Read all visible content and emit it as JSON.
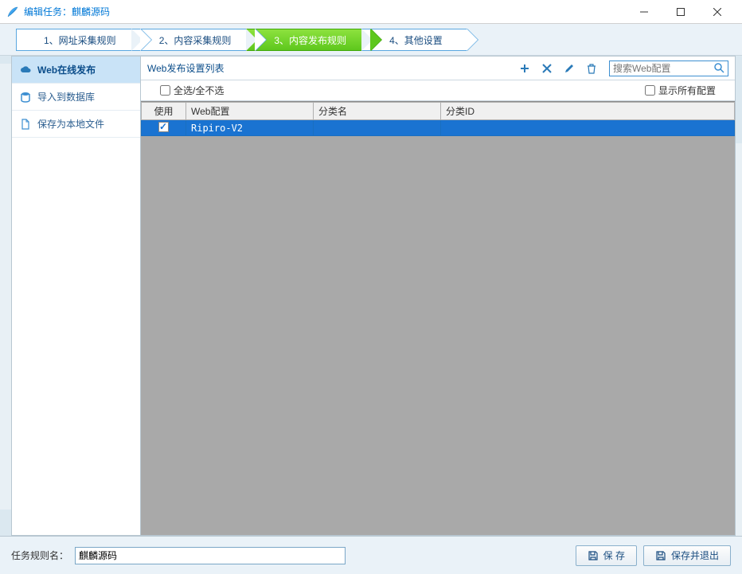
{
  "titlebar": {
    "title": "编辑任务：麒麟源码"
  },
  "steps": {
    "s1": "1、网址采集规则",
    "s2": "2、内容采集规则",
    "s3": "3、内容发布规则",
    "s4": "4、其他设置"
  },
  "sidebar": {
    "items": [
      {
        "label": "Web在线发布",
        "icon": "cloud-icon"
      },
      {
        "label": "导入到数据库",
        "icon": "database-icon"
      },
      {
        "label": "保存为本地文件",
        "icon": "file-icon"
      }
    ]
  },
  "toolbar": {
    "list_label": "Web发布设置列表",
    "search_placeholder": "搜索Web配置"
  },
  "checks": {
    "select_all": "全选/全不选",
    "show_all": "显示所有配置"
  },
  "table": {
    "headers": {
      "use": "使用",
      "cfg": "Web配置",
      "cat": "分类名",
      "cid": "分类ID"
    },
    "rows": [
      {
        "checked": true,
        "cfg": "Ripiro-V2",
        "cat": "",
        "cid": ""
      }
    ]
  },
  "footer": {
    "label": "任务规则名：",
    "value": "麒麟源码",
    "save": "保 存",
    "save_exit": "保存并退出"
  }
}
